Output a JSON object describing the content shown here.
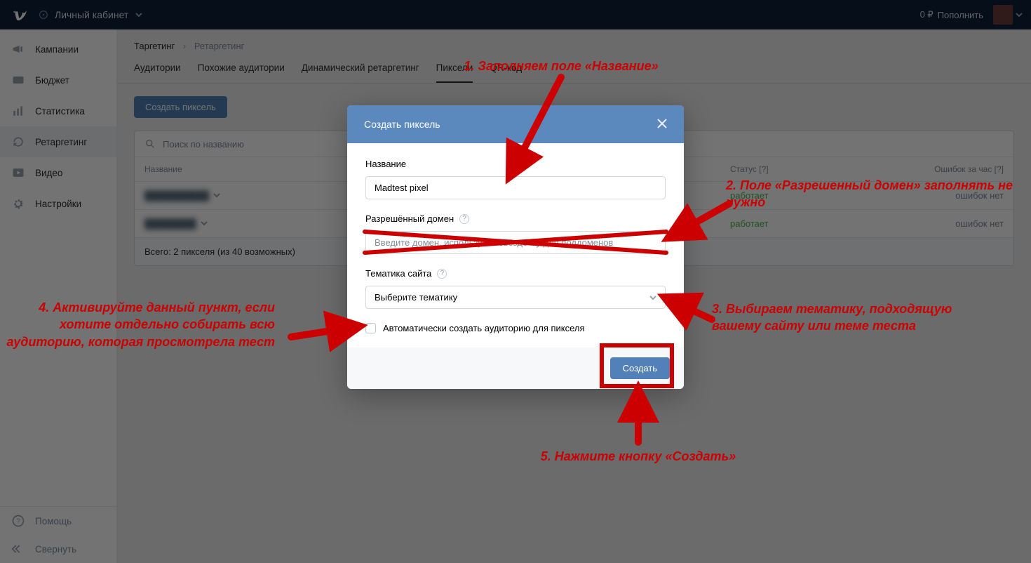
{
  "topbar": {
    "account_label": "Личный кабинет",
    "balance": "0 ₽",
    "topup": "Пополнить"
  },
  "sidebar": {
    "items": [
      {
        "label": "Кампании"
      },
      {
        "label": "Бюджет"
      },
      {
        "label": "Статистика"
      },
      {
        "label": "Ретаргетинг"
      },
      {
        "label": "Видео"
      },
      {
        "label": "Настройки"
      }
    ],
    "bottom": [
      {
        "label": "Помощь"
      },
      {
        "label": "Свернуть"
      }
    ]
  },
  "breadcrumb": {
    "root": "Таргетинг",
    "current": "Ретаргетинг"
  },
  "tabs": [
    {
      "label": "Аудитории"
    },
    {
      "label": "Похожие аудитории"
    },
    {
      "label": "Динамический ретаргетинг"
    },
    {
      "label": "Пиксели",
      "active": true
    },
    {
      "label": "QR-код"
    }
  ],
  "toolbar": {
    "create_pixel": "Создать пиксель"
  },
  "table": {
    "search_placeholder": "Поиск по названию",
    "col_name": "Название",
    "col_status": "Статус [?]",
    "col_errors": "Ошибок за час [?]",
    "rows": [
      {
        "name": "██████████",
        "status": "работает",
        "errors": "ошибок нет"
      },
      {
        "name": "████████",
        "status": "работает",
        "errors": "ошибок нет"
      }
    ],
    "footer": "Всего: 2 пикселя (из 40 возможных)"
  },
  "modal": {
    "title": "Создать пиксель",
    "field_name_label": "Название",
    "field_name_value": "Madtest pixel",
    "field_domain_label": "Разрешённый домен",
    "field_domain_placeholder": "Введите домен, используйте звёздочку для поддоменов",
    "field_theme_label": "Тематика сайта",
    "field_theme_placeholder": "Выберите тематику",
    "checkbox_label": "Автоматически создать аудиторию для пикселя",
    "submit": "Создать"
  },
  "annotations": {
    "a1": "1. Заполняем поле «Название»",
    "a2": "2. Поле «Разрешенный домен» заполнять не нужно",
    "a3": "3. Выбираем тематику, подходящую вашему сайту или теме теста",
    "a4": "4. Активируйте данный пункт, если хотите отдельно собирать всю аудиторию, которая просмотрела тест",
    "a5": "5. Нажмите кнопку «Создать»"
  }
}
